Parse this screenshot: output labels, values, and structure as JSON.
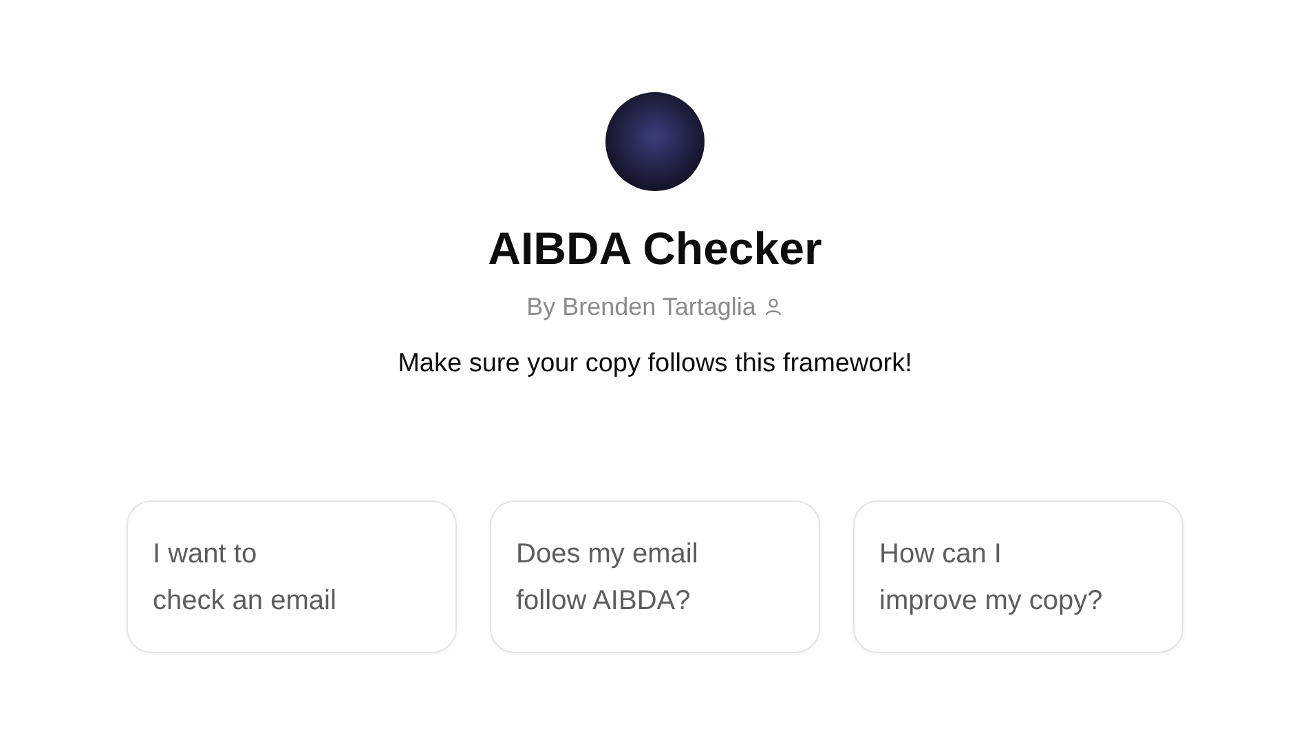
{
  "gpt": {
    "name": "AIBDA Checker",
    "author": "By Brenden Tartaglia",
    "description": "Make sure your copy follows this framework!"
  },
  "prompts": [
    {
      "text": "I want to\ncheck an email"
    },
    {
      "text": "Does my email\nfollow AIBDA?"
    },
    {
      "text": "How can I\nimprove my copy?"
    }
  ]
}
